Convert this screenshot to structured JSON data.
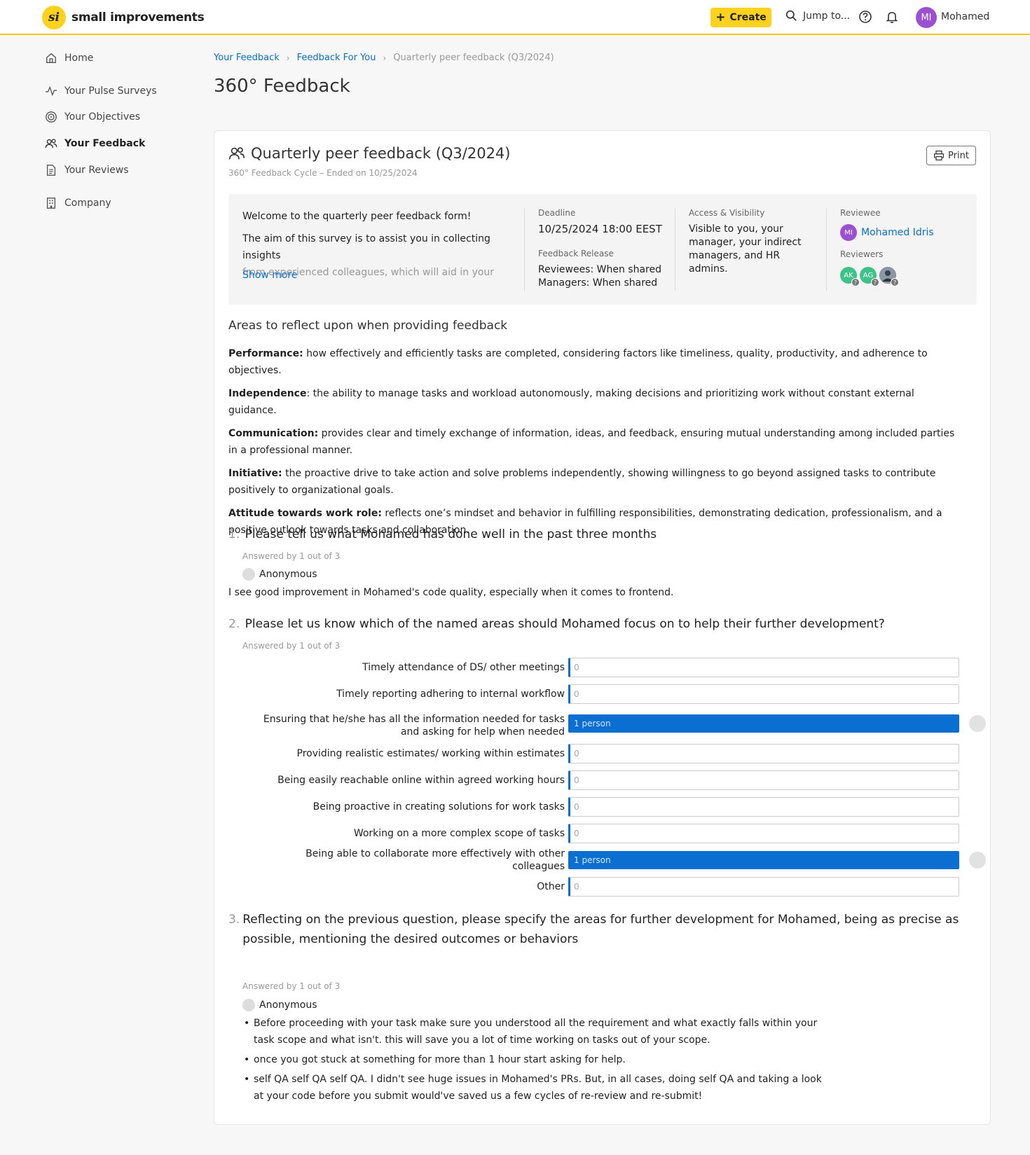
{
  "brand": {
    "name": "small improvements",
    "mark": "si"
  },
  "topbar": {
    "create_label": "Create",
    "jump_label": "Jump to...",
    "user_initials": "MI",
    "user_name": "Mohamed"
  },
  "sidebar": {
    "items": [
      {
        "label": "Home",
        "icon": "home-icon"
      },
      {
        "label": "Your Pulse Surveys",
        "icon": "pulse-icon"
      },
      {
        "label": "Your Objectives",
        "icon": "target-icon"
      },
      {
        "label": "Your Feedback",
        "icon": "people-icon",
        "active": true
      },
      {
        "label": "Your Reviews",
        "icon": "document-icon"
      },
      {
        "label": "Company",
        "icon": "building-icon"
      }
    ]
  },
  "breadcrumb": {
    "items": [
      "Your Feedback",
      "Feedback For You"
    ],
    "current": "Quarterly peer feedback (Q3/2024)"
  },
  "page_title": "360° Feedback",
  "card": {
    "title": "Quarterly peer feedback (Q3/2024)",
    "subtitle": "360° Feedback Cycle – Ended on 10/25/2024",
    "print_label": "Print",
    "intro_1": "Welcome to the quarterly peer feedback form!",
    "intro_2": "The aim of this survey is to assist you in collecting insights",
    "intro_3": "from experienced colleagues, which will aid in your",
    "show_more": "Show more",
    "deadline_label": "Deadline",
    "deadline_value": "10/25/2024 18:00 EEST",
    "release_label": "Feedback Release",
    "release_reviewees": "Reviewees: When shared",
    "release_managers": "Managers: When shared",
    "access_label": "Access & Visibility",
    "access_value": "Visible to you, your manager, your indirect managers, and HR admins.",
    "reviewee_label": "Reviewee",
    "reviewee_initials": "MI",
    "reviewee_name": "Mohamed Idris",
    "reviewers_label": "Reviewers",
    "reviewers": [
      {
        "initials": "AK",
        "color": "#3fc28a"
      },
      {
        "initials": "AG",
        "color": "#3fc28a"
      },
      {
        "initials": "",
        "color": "#6d7b8a"
      }
    ]
  },
  "areas": {
    "title": "Areas to reflect upon when providing feedback",
    "items": [
      {
        "term": "Performance:",
        "text": " how effectively and efficiently tasks are completed, considering factors like timeliness, quality, productivity, and adherence to objectives."
      },
      {
        "term": "Independence",
        "text": ": the ability to manage tasks and workload autonomously, making decisions and prioritizing work without constant external guidance."
      },
      {
        "term": "Communication:",
        "text": " provides clear and timely exchange of information, ideas, and feedback, ensuring mutual understanding among included parties in a professional manner."
      },
      {
        "term": "Initiative:",
        "text": " the proactive drive to take action and solve problems independently, showing willingness to go beyond assigned tasks to contribute positively to organizational goals."
      },
      {
        "term": "Attitude towards work role:",
        "text": " reflects one’s mindset and behavior in fulfilling responsibilities, demonstrating dedication, professionalism, and a positive outlook towards tasks and collaboration."
      }
    ]
  },
  "q1": {
    "num": "1.",
    "text": "Please tell us what Mohamed has done well in the past three months",
    "answered": "Answered by 1 out of 3",
    "author": "Anonymous",
    "answer": "I see good improvement in Mohamed's code quality, especially when it comes to frontend."
  },
  "q2": {
    "num": "2.",
    "text": "Please let us know which of the named areas should Mohamed focus on to help their  further development?",
    "answered": "Answered by 1 out of 3",
    "options": [
      {
        "label": "Timely attendance of DS/ other meetings",
        "value": "0",
        "count": 0
      },
      {
        "label": "Timely reporting adhering to internal workflow",
        "value": "0",
        "count": 0
      },
      {
        "label": "Ensuring that he/she has all the information needed for tasks and asking for help when needed",
        "value": "1 person",
        "count": 1
      },
      {
        "label": "Providing realistic estimates/ working within estimates",
        "value": "0",
        "count": 0
      },
      {
        "label": "Being easily reachable online within agreed working hours",
        "value": "0",
        "count": 0
      },
      {
        "label": "Being proactive in creating solutions for work tasks",
        "value": "0",
        "count": 0
      },
      {
        "label": "Working on a more complex scope of tasks",
        "value": "0",
        "count": 0
      },
      {
        "label": "Being able to collaborate more effectively with other colleagues",
        "value": "1 person",
        "count": 1
      },
      {
        "label": "Other",
        "value": "0",
        "count": 0
      }
    ]
  },
  "q3": {
    "num": "3.",
    "text": "Reflecting on the previous question, please specify the areas for further development for Mohamed, being as precise as possible, mentioning the desired outcomes or behaviors",
    "answered": "Answered by 1 out of 3",
    "author": "Anonymous",
    "bullets": [
      "Before proceeding with your task make sure you understood all the requirement and what exactly falls within your task scope and what isn't. this will save you a lot of time working on tasks out of your scope.",
      "once you got stuck at something for more than 1 hour start asking for help.",
      "self QA self QA self QA. I didn't see huge issues in Mohamed's PRs. But, in all cases, doing self QA and taking a look at your code before you submit would've saved us a few cycles of re-review and re-submit!"
    ]
  },
  "colors": {
    "accent": "#fdd21f",
    "link": "#0a6fd0",
    "avatar": "#9b4fd1"
  }
}
